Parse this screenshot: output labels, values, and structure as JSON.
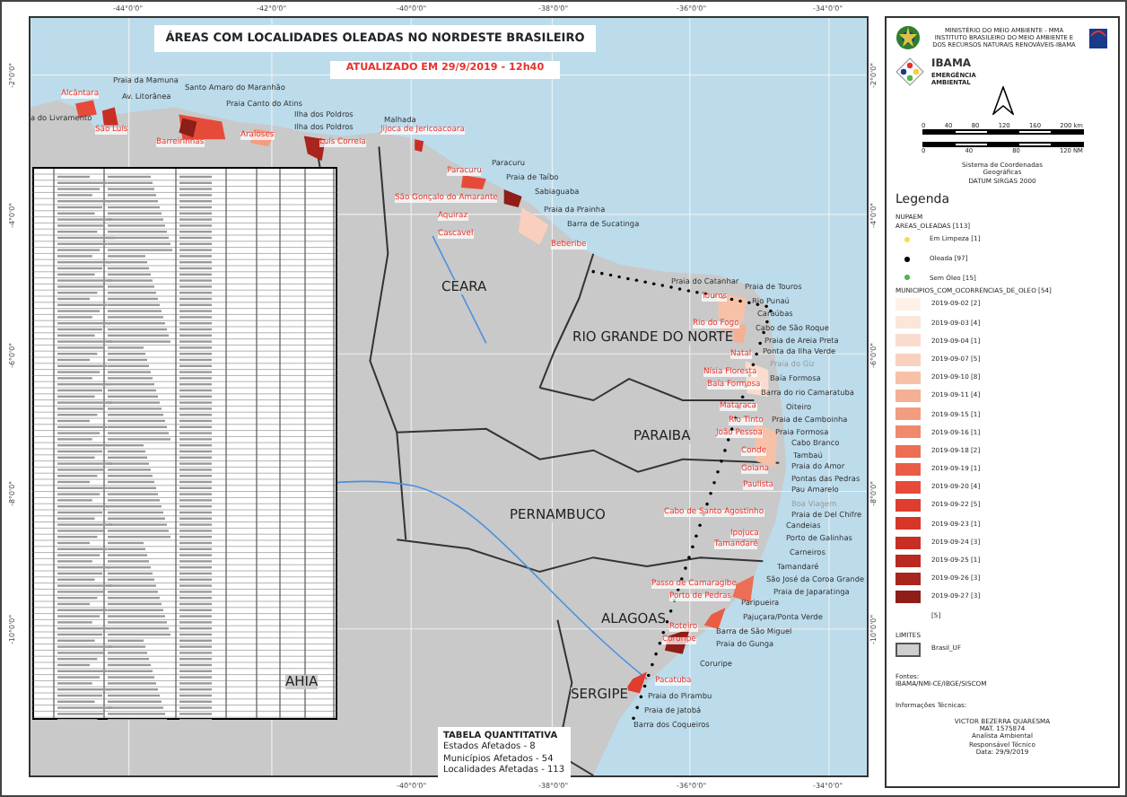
{
  "title": "ÁREAS COM LOCALIDADES OLEADAS NO NORDESTE BRASILEIRO",
  "subtitle": "ATUALIZADO EM 29/9/2019 - 12h40",
  "graticule": {
    "top": [
      "-44°0'0\"",
      "-42°0'0\"",
      "-40°0'0\"",
      "-38°0'0\"",
      "-36°0'0\"",
      "-34°0'0\""
    ],
    "bottom": [
      "-40°0'0\"",
      "-38°0'0\"",
      "-36°0'0\"",
      "-34°0'0\""
    ],
    "left": [
      "-2°0'0\"",
      "-4°0'0\"",
      "-6°0'0\"",
      "-8°0'0\"",
      "-10°0'0\""
    ],
    "right": [
      "-2°0'0\"",
      "-4°0'0\"",
      "-6°0'0\"",
      "-8°0'0\"",
      "-10°0'0\""
    ]
  },
  "map_labels": [
    {
      "text": "Alcântara",
      "kind": "municipality"
    },
    {
      "text": "Praia da Mamuna",
      "kind": "locality"
    },
    {
      "text": "Santo Amaro do Maranhão",
      "kind": "locality"
    },
    {
      "text": "Av. Litorânea",
      "kind": "locality"
    },
    {
      "text": "Praia Canto do Atins",
      "kind": "locality"
    },
    {
      "text": "a do Livramento",
      "kind": "locality"
    },
    {
      "text": "São Luís",
      "kind": "municipality"
    },
    {
      "text": "Ilha dos Poldros",
      "kind": "locality"
    },
    {
      "text": "Ilha dos Poldros",
      "kind": "locality"
    },
    {
      "text": "Barreirinhas",
      "kind": "municipality"
    },
    {
      "text": "Araioses",
      "kind": "municipality"
    },
    {
      "text": "Luís Correia",
      "kind": "municipality"
    },
    {
      "text": "Malhada",
      "kind": "locality"
    },
    {
      "text": "Jijoca de Jericoacoara",
      "kind": "municipality"
    },
    {
      "text": "Paracuru",
      "kind": "locality"
    },
    {
      "text": "Paracuru",
      "kind": "municipality"
    },
    {
      "text": "Praia de Taíbo",
      "kind": "locality"
    },
    {
      "text": "Sabiaguaba",
      "kind": "locality"
    },
    {
      "text": "São Gonçalo do Amarante",
      "kind": "municipality"
    },
    {
      "text": "Praia da Prainha",
      "kind": "locality"
    },
    {
      "text": "Aquiraz",
      "kind": "municipality"
    },
    {
      "text": "Barra de Sucatinga",
      "kind": "locality"
    },
    {
      "text": "Cascavel",
      "kind": "municipality"
    },
    {
      "text": "Beberibe",
      "kind": "municipality"
    },
    {
      "text": "CEARA",
      "kind": "state"
    },
    {
      "text": "Praia do Catanhar",
      "kind": "locality"
    },
    {
      "text": "Praia de Touros",
      "kind": "locality"
    },
    {
      "text": "Touros",
      "kind": "municipality"
    },
    {
      "text": "Rio Punaú",
      "kind": "locality"
    },
    {
      "text": "Caraúbas",
      "kind": "locality"
    },
    {
      "text": "Rio do Fogo",
      "kind": "municipality"
    },
    {
      "text": "RIO GRANDE DO NORTE",
      "kind": "state"
    },
    {
      "text": "Cabo de São Roque",
      "kind": "locality"
    },
    {
      "text": "Praia de Areia Preta",
      "kind": "locality"
    },
    {
      "text": "Natal",
      "kind": "municipality"
    },
    {
      "text": "Ponta da Ilha Verde",
      "kind": "locality"
    },
    {
      "text": "Praia do Giz",
      "kind": "faded"
    },
    {
      "text": "Nísia Floresta",
      "kind": "municipality"
    },
    {
      "text": "Baía Formosa",
      "kind": "locality"
    },
    {
      "text": "Baía Formosa",
      "kind": "municipality"
    },
    {
      "text": "Barra do rio Camaratuba",
      "kind": "locality"
    },
    {
      "text": "Mataraca",
      "kind": "municipality"
    },
    {
      "text": "Oiteiro",
      "kind": "locality"
    },
    {
      "text": "Rio Tinto",
      "kind": "municipality"
    },
    {
      "text": "Praia de Camboinha",
      "kind": "locality"
    },
    {
      "text": "PARAIBA",
      "kind": "state"
    },
    {
      "text": "João Pessoa",
      "kind": "municipality"
    },
    {
      "text": "Praia Formosa",
      "kind": "locality"
    },
    {
      "text": "Cabo Branco",
      "kind": "locality"
    },
    {
      "text": "Conde",
      "kind": "municipality"
    },
    {
      "text": "Tambaú",
      "kind": "locality"
    },
    {
      "text": "Goiana",
      "kind": "municipality"
    },
    {
      "text": "Praia do Amor",
      "kind": "locality"
    },
    {
      "text": "Pontas das Pedras",
      "kind": "locality"
    },
    {
      "text": "Paulista",
      "kind": "municipality"
    },
    {
      "text": "Pau Amarelo",
      "kind": "locality"
    },
    {
      "text": "Boa Viagem",
      "kind": "faded"
    },
    {
      "text": "PERNAMBUCO",
      "kind": "state"
    },
    {
      "text": "Cabo de Santo Agostinho",
      "kind": "municipality"
    },
    {
      "text": "Praia de Del Chifre",
      "kind": "locality"
    },
    {
      "text": "Candeias",
      "kind": "locality"
    },
    {
      "text": "Ipojuca",
      "kind": "municipality"
    },
    {
      "text": "Porto de Galinhas",
      "kind": "locality"
    },
    {
      "text": "Tamandaré",
      "kind": "municipality"
    },
    {
      "text": "Carneiros",
      "kind": "locality"
    },
    {
      "text": "Tamandaré",
      "kind": "locality"
    },
    {
      "text": "São José da Coroa Grande",
      "kind": "locality"
    },
    {
      "text": "Passo de Camaragibe",
      "kind": "municipality"
    },
    {
      "text": "Porto de Pedras",
      "kind": "municipality"
    },
    {
      "text": "Praia de Japaratinga",
      "kind": "locality"
    },
    {
      "text": "Paripueira",
      "kind": "locality"
    },
    {
      "text": "ALAGOAS",
      "kind": "state"
    },
    {
      "text": "Pajuçara/Ponta Verde",
      "kind": "locality"
    },
    {
      "text": "Roteiro",
      "kind": "municipality"
    },
    {
      "text": "Barra de São Miguel",
      "kind": "locality"
    },
    {
      "text": "Coruripe",
      "kind": "municipality"
    },
    {
      "text": "Praia do Gunga",
      "kind": "locality"
    },
    {
      "text": "Coruripe",
      "kind": "locality"
    },
    {
      "text": "Pacatuba",
      "kind": "municipality"
    },
    {
      "text": "SERGIPE",
      "kind": "state"
    },
    {
      "text": "Praia do Pirambu",
      "kind": "locality"
    },
    {
      "text": "Praia de Jatobá",
      "kind": "locality"
    },
    {
      "text": "Barra dos Coqueiros",
      "kind": "locality"
    },
    {
      "text": "AHIA",
      "kind": "state"
    }
  ],
  "summary_table": {
    "title": "TABELA QUANTITATIVA",
    "lines": [
      "Estados Afetados - 8",
      "Municípios Afetados - 54",
      "Localidades Afetadas - 113"
    ]
  },
  "header": [
    "MINISTÉRIO DO MEIO AMBIENTE - MMA",
    "INSTITUTO BRASILEIRO DO MEIO AMBIENTE E",
    "DOS RECURSOS NATURAIS RENOVÁVEIS-IBAMA"
  ],
  "agency": {
    "name": "IBAMA",
    "unit": "EMERGÊNCIA AMBIENTAL"
  },
  "scale": {
    "km": [
      "0",
      "40",
      "80",
      "120",
      "160",
      "200 km"
    ],
    "nm": [
      "0",
      "40",
      "80",
      "120 NM"
    ]
  },
  "crs": [
    "Sistema de Coordenadas",
    "Geográficas",
    "DATUM SIRGAS 2000"
  ],
  "legend": {
    "title": "Legenda",
    "group": "NUPAEM",
    "points_title": "AREAS_OLEADAS [113]",
    "points": [
      {
        "label": "Em Limpeza [1]",
        "color": "#f2e14c"
      },
      {
        "label": "Oleada [97]",
        "color": "#000000"
      },
      {
        "label": "Sem Óleo [15]",
        "color": "#4cb848"
      }
    ],
    "municipios_title": "MUNICIPIOS_COM_OCORRENCIAS_DE_OLEO [54]",
    "municipios": [
      {
        "label": "2019-09-02 [2]",
        "color": "#fdf1e8"
      },
      {
        "label": "2019-09-03 [4]",
        "color": "#fbe6da"
      },
      {
        "label": "2019-09-04 [1]",
        "color": "#f9dccd"
      },
      {
        "label": "2019-09-07 [5]",
        "color": "#f8d0bd"
      },
      {
        "label": "2019-09-10 [8]",
        "color": "#f6c1a7"
      },
      {
        "label": "2019-09-11 [4]",
        "color": "#f4b095"
      },
      {
        "label": "2019-09-15 [1]",
        "color": "#f29d80"
      },
      {
        "label": "2019-09-16 [1]",
        "color": "#ef8a6c"
      },
      {
        "label": "2019-09-18 [2]",
        "color": "#ec6f55"
      },
      {
        "label": "2019-09-19 [1]",
        "color": "#e95d47"
      },
      {
        "label": "2019-09-20 [4]",
        "color": "#e64b3a"
      },
      {
        "label": "2019-09-22 [5]",
        "color": "#df3d2f"
      },
      {
        "label": "2019-09-23 [1]",
        "color": "#d73528"
      },
      {
        "label": "2019-09-24 [3]",
        "color": "#c92e24"
      },
      {
        "label": "2019-09-25 [1]",
        "color": "#ba2a20"
      },
      {
        "label": "2019-09-26 [3]",
        "color": "#a9251d"
      },
      {
        "label": "2019-09-27 [3]",
        "color": "#8e1e17"
      },
      {
        "label": "[5]"
      }
    ],
    "limits_title": "LIMITES",
    "limits": [
      {
        "label": "Brasil_UF",
        "color": "#cfcfcf"
      }
    ]
  },
  "sources": {
    "title": "Fontes:",
    "text": "IBAMA/NMI-CE/IBGE/SISCOM"
  },
  "technical": {
    "title": "Informações Técnicas:",
    "lines": [
      "VICTOR BEZERRA QUARESMA",
      "MAT. 1575874",
      "Analista Ambiental",
      "Responsável Técnico",
      "Data: 29/9/2019"
    ]
  }
}
